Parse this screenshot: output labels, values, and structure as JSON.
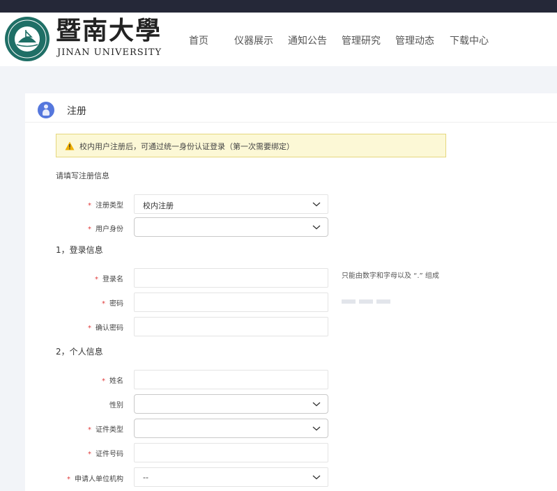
{
  "header": {
    "logo_cn": "暨南大學",
    "logo_en": "JINAN UNIVERSITY",
    "nav": [
      "首页",
      "仪器展示",
      "通知公告",
      "管理研究",
      "管理动态",
      "下载中心"
    ]
  },
  "panel": {
    "title": "注册",
    "notice": "校内用户注册后，可通过统一身份认证登录（第一次需要绑定）",
    "hint": "请填写注册信息",
    "sections": {
      "login_info": "1，登录信息",
      "personal_info": "2，个人信息"
    },
    "fields": {
      "reg_type": {
        "label": "注册类型",
        "value": "校内注册",
        "required": true
      },
      "user_identity": {
        "label": "用户身份",
        "value": "",
        "required": true
      },
      "login_name": {
        "label": "登录名",
        "value": "",
        "required": true,
        "note": "只能由数字和字母以及 “.” 组成"
      },
      "password": {
        "label": "密码",
        "value": "",
        "required": true
      },
      "confirm_password": {
        "label": "确认密码",
        "value": "",
        "required": true
      },
      "name": {
        "label": "姓名",
        "value": "",
        "required": true
      },
      "gender": {
        "label": "性别",
        "value": "",
        "required": false
      },
      "id_type": {
        "label": "证件类型",
        "value": "",
        "required": true
      },
      "id_number": {
        "label": "证件号码",
        "value": "",
        "required": true
      },
      "org": {
        "label": "申请人单位机构",
        "value": "--",
        "required": true
      }
    }
  },
  "colors": {
    "topbar": "#252838",
    "required": "#e03a3a",
    "notice_bg": "#fcf8d6",
    "notice_border": "#e5d77e",
    "title_icon": "#5577dd"
  },
  "icons": {
    "logo": "university-seal-icon",
    "title": "user-icon",
    "notice": "warning-icon",
    "select": "chevron-down-icon"
  }
}
